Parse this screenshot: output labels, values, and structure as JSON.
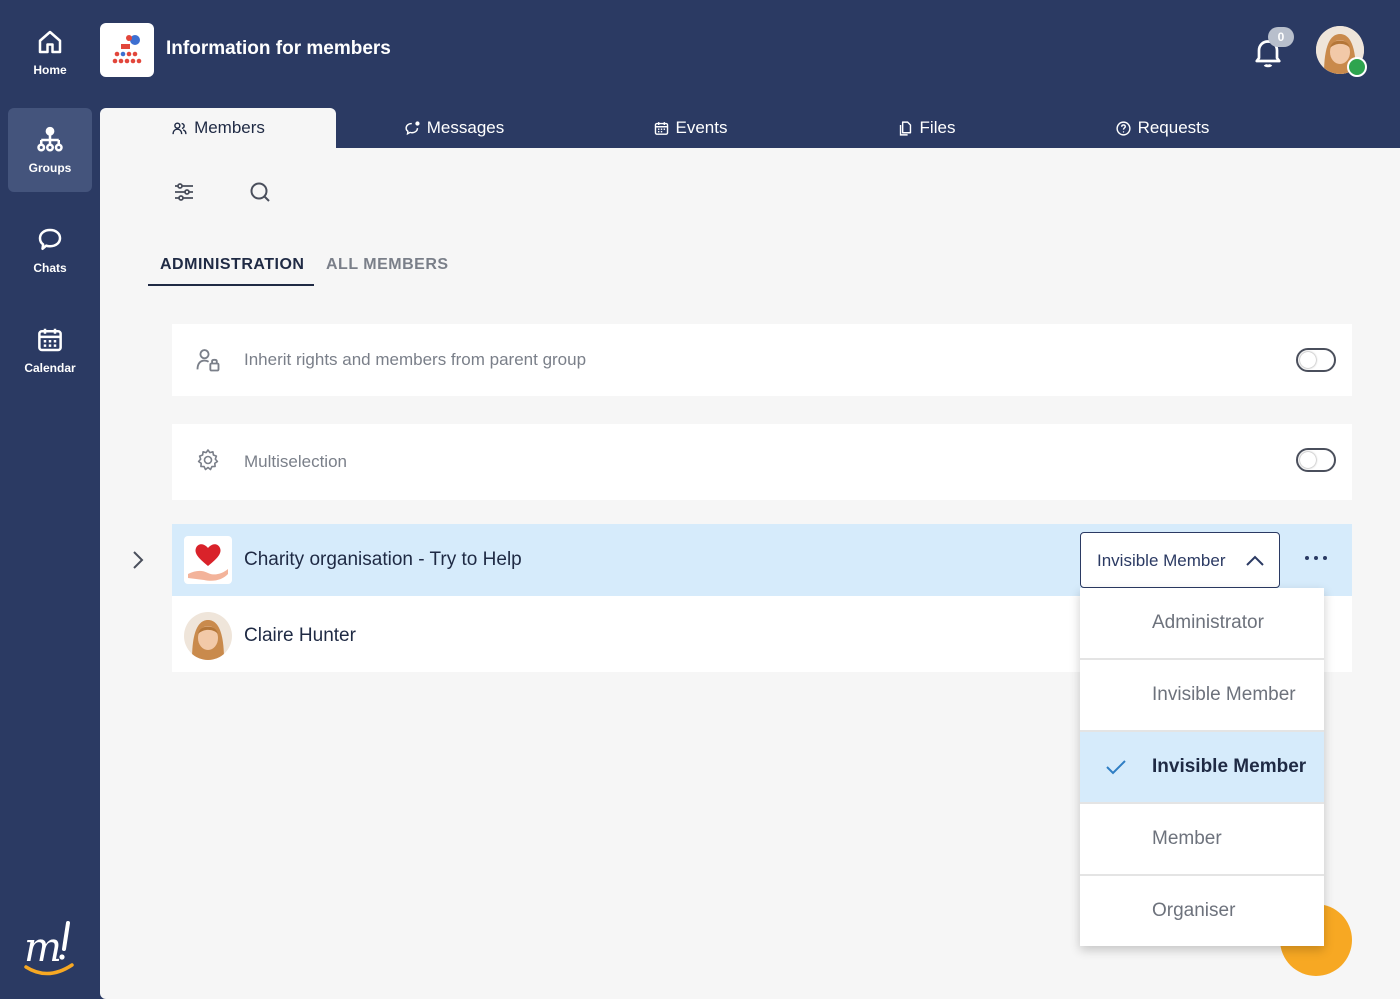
{
  "sidebar": {
    "items": [
      {
        "label": "Home",
        "icon": "home-icon"
      },
      {
        "label": "Groups",
        "icon": "groups-icon",
        "active": true
      },
      {
        "label": "Chats",
        "icon": "chat-bubble-icon"
      },
      {
        "label": "Calendar",
        "icon": "calendar-icon"
      }
    ]
  },
  "header": {
    "title": "Information for members",
    "notifications_count": "0"
  },
  "tabs": [
    {
      "label": "Members",
      "icon": "members-icon",
      "active": true
    },
    {
      "label": "Messages",
      "icon": "messages-icon"
    },
    {
      "label": "Events",
      "icon": "calendar-icon"
    },
    {
      "label": "Files",
      "icon": "files-icon"
    },
    {
      "label": "Requests",
      "icon": "help-circle-icon"
    }
  ],
  "subtabs": {
    "administration": "ADMINISTRATION",
    "all_members": "ALL MEMBERS"
  },
  "settings": {
    "inherit": "Inherit rights and members from parent group",
    "multiselection": "Multiselection"
  },
  "members": [
    {
      "name": "Charity organisation - Try to Help",
      "role": "Invisible Member"
    },
    {
      "name": "Claire Hunter"
    }
  ],
  "dropdown": {
    "options": [
      "Administrator",
      "Invisible Member",
      "Invisible Member",
      "Member",
      "Organiser"
    ],
    "selected_index": 2
  },
  "colors": {
    "navy": "#2b3a63",
    "highlight": "#d6ebfb",
    "fab": "#f7a823",
    "status_online": "#2ea44f"
  }
}
